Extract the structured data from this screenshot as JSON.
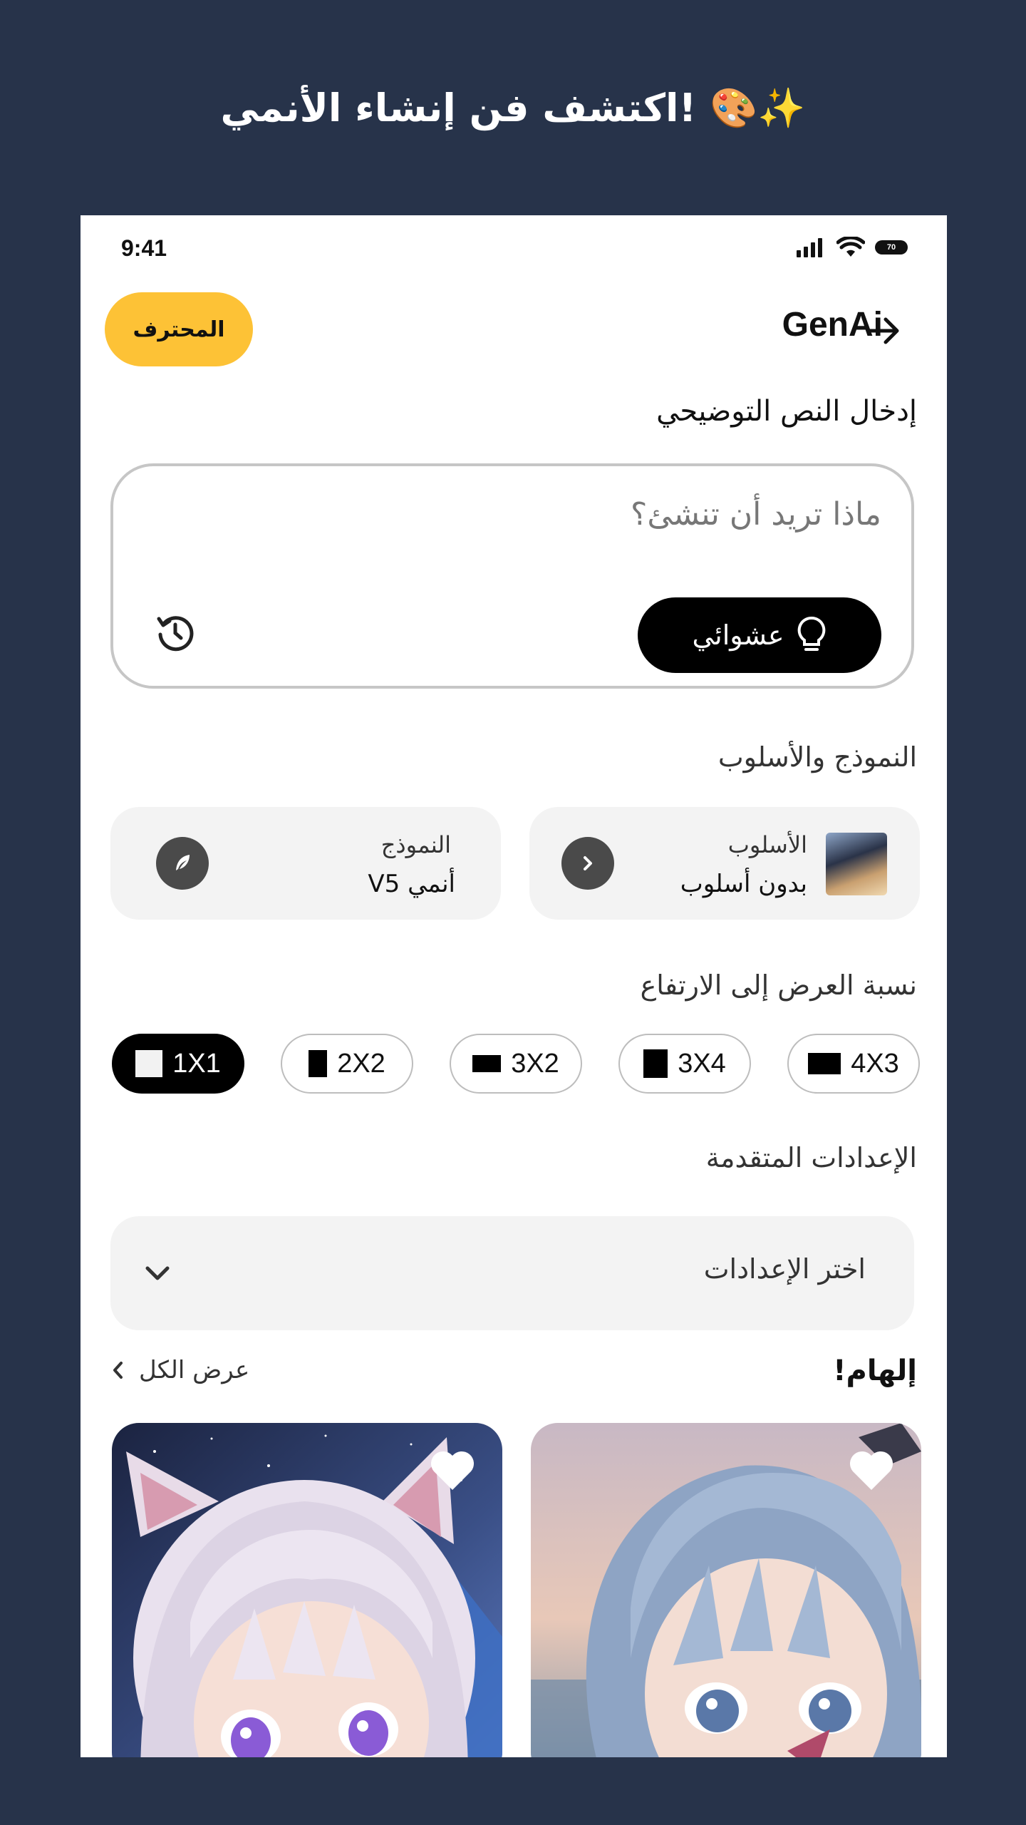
{
  "headline": "اكتشف فن إنشاء الأنمي! 🎨✨",
  "status": {
    "time": "9:41",
    "battery": "70"
  },
  "header": {
    "pro_label": "المحترف",
    "brand": "GenAi"
  },
  "prompt": {
    "label": "إدخال النص التوضيحي",
    "placeholder": "ماذا تريد أن تنشئ؟",
    "random_label": "عشوائي"
  },
  "model_style": {
    "label": "النموذج والأسلوب",
    "style_card": {
      "title": "الأسلوب",
      "value": "بدون أسلوب"
    },
    "model_card": {
      "title": "النموذج",
      "value": "أنمي V5"
    }
  },
  "aspect": {
    "label": "نسبة العرض إلى الارتفاع",
    "options": [
      "1X1",
      "2X2",
      "3X2",
      "3X4",
      "4X3"
    ],
    "selected": "1X1"
  },
  "advanced": {
    "label": "الإعدادات المتقدمة",
    "select_placeholder": "اختر الإعدادات"
  },
  "inspire": {
    "title": "إلهام!",
    "view_all": "عرض الكل"
  }
}
